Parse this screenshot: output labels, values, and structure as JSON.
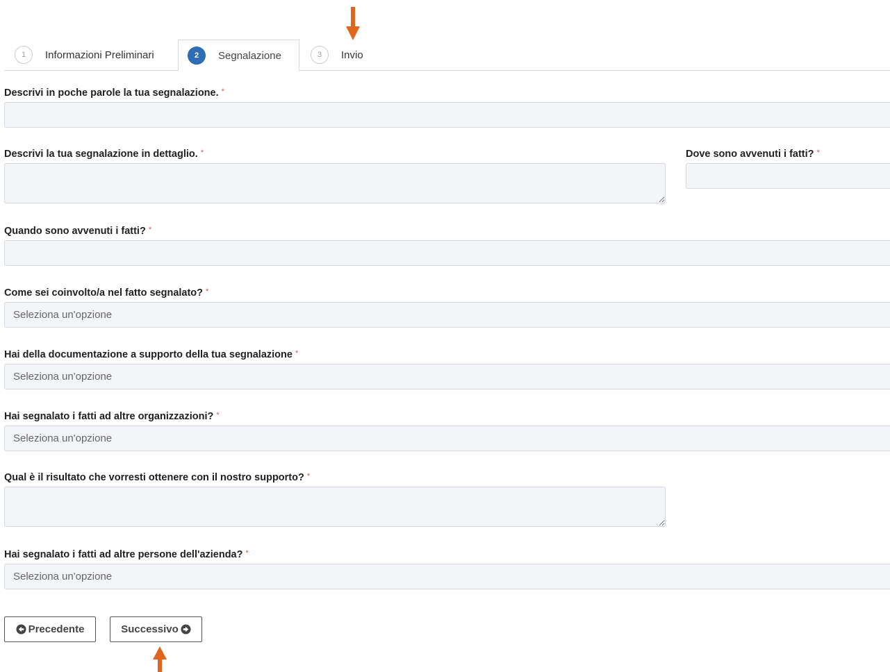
{
  "tabs": [
    {
      "number": "1",
      "label": "Informazioni Preliminari"
    },
    {
      "number": "2",
      "label": "Segnalazione"
    },
    {
      "number": "3",
      "label": "Invio"
    }
  ],
  "required_mark": "*",
  "form": {
    "short_description_label": "Descrivi in poche parole la tua segnalazione.",
    "detailed_description_label": "Descrivi la tua segnalazione in dettaglio.",
    "where_label": "Dove sono avvenuti i fatti?",
    "when_label": "Quando sono avvenuti i fatti?",
    "involvement_label": "Come sei coinvolto/a nel fatto segnalato?",
    "involvement_value": "Seleziona un'opzione",
    "documentation_label": "Hai della documentazione a supporto della tua segnalazione",
    "documentation_value": "Seleziona un'opzione",
    "other_orgs_label": "Hai segnalato i fatti ad altre organizzazioni?",
    "other_orgs_value": "Seleziona un'opzione",
    "desired_result_label": "Qual è il risultato che vorresti ottenere con il nostro supporto?",
    "other_people_label": "Hai segnalato i fatti ad altre persone dell'azienda?",
    "other_people_value": "Seleziona un'opzione"
  },
  "buttons": {
    "previous": "Precedente",
    "next": "Successivo"
  },
  "colors": {
    "annotation_arrow": "#e0661f",
    "active_step": "#2f6db5",
    "required": "#d9534f",
    "field_bg": "#f3f5f8"
  }
}
